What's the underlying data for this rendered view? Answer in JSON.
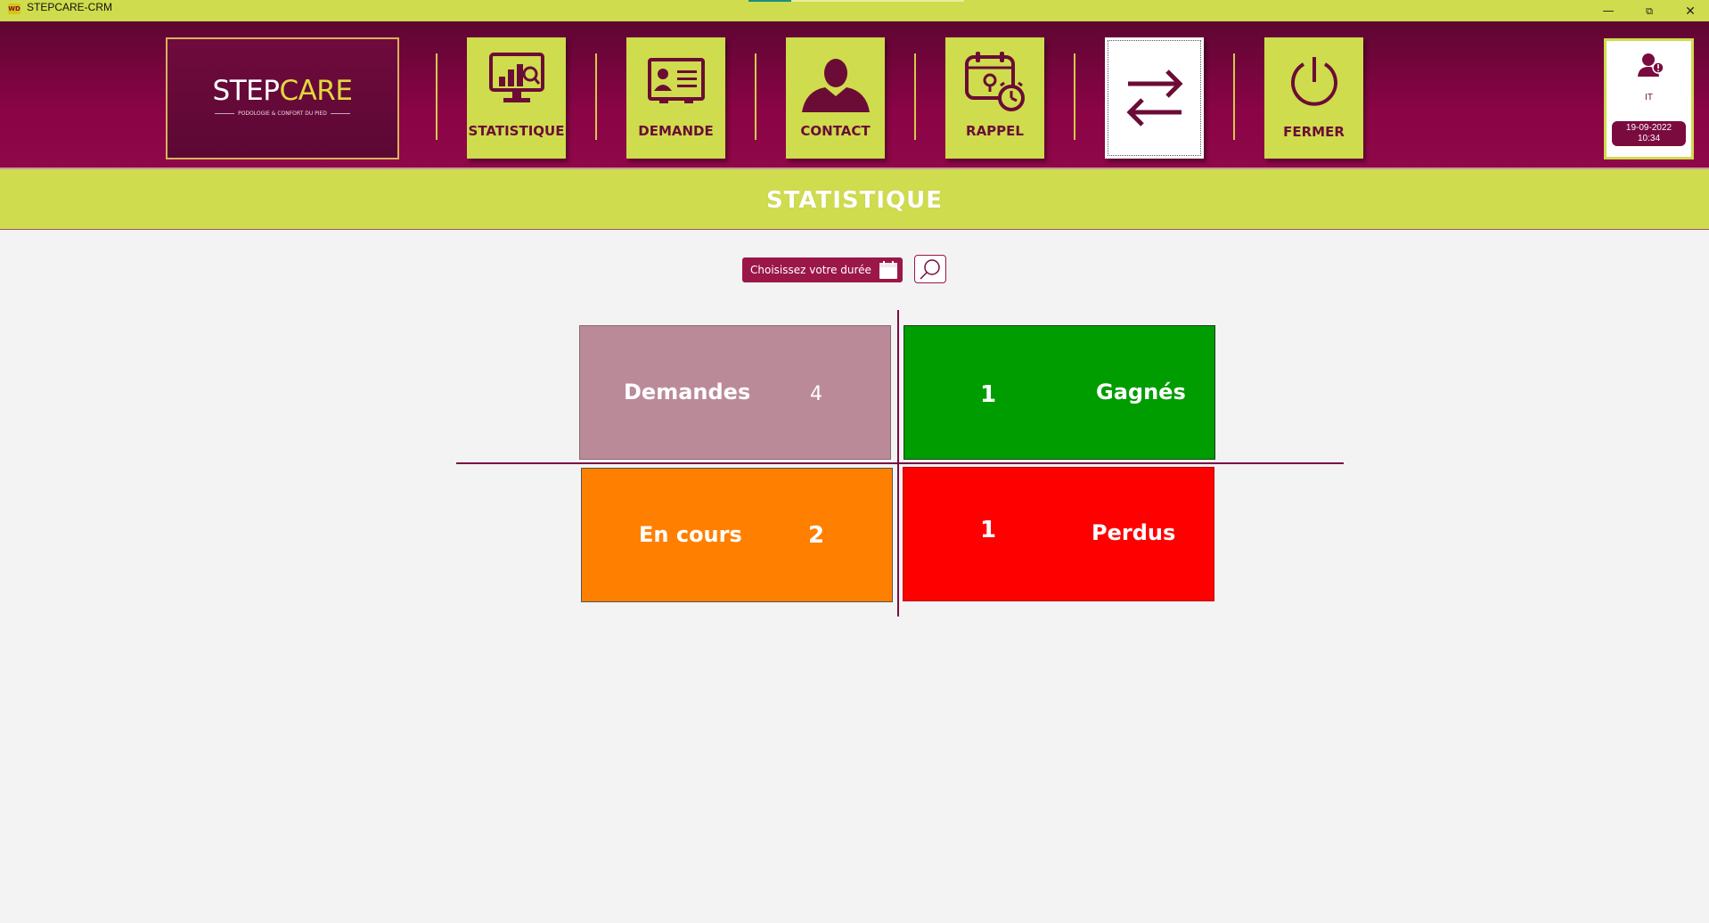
{
  "window": {
    "title": "STEPCARE-CRM",
    "app_icon_text": "WD",
    "minimize": "—",
    "maximize": "⧉",
    "close": "✕"
  },
  "logo": {
    "step": "STEP",
    "care": "CARE",
    "tagline": "PODOLOGIE & CONFORT DU PIED"
  },
  "nav": [
    {
      "label": "STATISTIQUE",
      "icon": "statistics-monitor-icon"
    },
    {
      "label": "DEMANDE",
      "icon": "id-card-icon"
    },
    {
      "label": "CONTACT",
      "icon": "person-silhouette-icon"
    },
    {
      "label": "RAPPEL",
      "icon": "calendar-clock-icon"
    },
    {
      "label": "",
      "icon": "swap-arrows-icon"
    },
    {
      "label": "FERMER",
      "icon": "power-icon"
    }
  ],
  "user": {
    "name": "IT",
    "date": "19-09-2022",
    "time": "10:34",
    "icon": "user-alert-icon"
  },
  "section": {
    "title": "STATISTIQUE"
  },
  "filter": {
    "period_label": "Choisissez votre durée",
    "calendar_icon": "calendar-icon",
    "search_icon": "search-icon"
  },
  "stats": {
    "demandes": {
      "label": "Demandes",
      "value": "4",
      "color": "#bb8a99"
    },
    "gagnes": {
      "label": "Gagnés",
      "value": "1",
      "color": "#009d00"
    },
    "en_cours": {
      "label": "En cours",
      "value": "2",
      "color": "#ff7f00"
    },
    "perdus": {
      "label": "Perdus",
      "value": "1",
      "color": "#ff0000"
    }
  },
  "colors": {
    "header_burgundy": "#8a0446",
    "lime": "#cfdc4d",
    "nav_text": "#6b0c36"
  }
}
